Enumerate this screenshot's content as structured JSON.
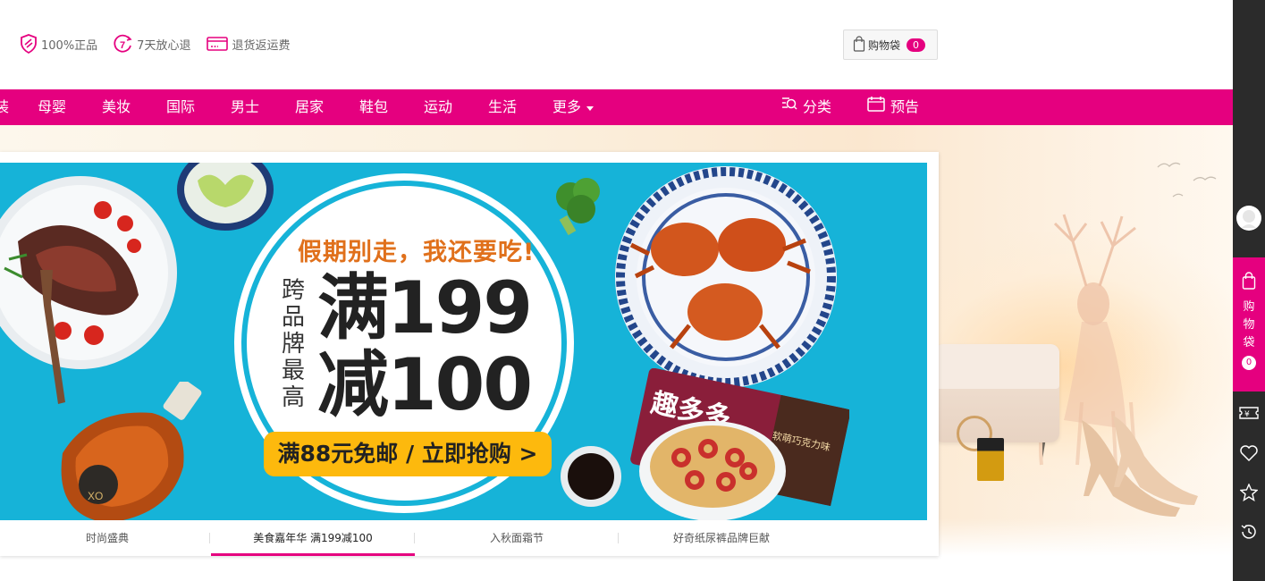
{
  "header": {
    "promises": [
      {
        "icon": "shield-icon",
        "label": "100%正品"
      },
      {
        "icon": "seven-days-icon",
        "label": "7天放心退"
      },
      {
        "icon": "card-icon",
        "label": "退货返运费"
      }
    ],
    "bag": {
      "label": "购物袋",
      "count": "0"
    }
  },
  "nav": {
    "items": [
      "母婴",
      "美妆",
      "国际",
      "男士",
      "居家",
      "鞋包",
      "运动",
      "生活",
      "更多"
    ],
    "category_label": "分类",
    "preview_label": "预告"
  },
  "banner": {
    "tagline": "假期别走，我还要吃!",
    "vertical_text": "跨品牌最高",
    "big_line1": "满199",
    "big_line2": "减100",
    "cta": "满88元免邮 / 立即抢购 >",
    "package_text": "趣多多",
    "package_sub": "软萌巧克力味"
  },
  "tabs": [
    "时尚盛典",
    "美食嘉年华 满199减100",
    "入秋面霜节",
    "好奇纸尿裤品牌巨献"
  ],
  "sidebar": {
    "bag_label": "购物袋",
    "bag_count": "0"
  },
  "colors": {
    "brand": "#e5007f",
    "banner_bg": "#16b3d8",
    "cta": "#fdb90d",
    "sidebar": "#2b2b2b"
  }
}
